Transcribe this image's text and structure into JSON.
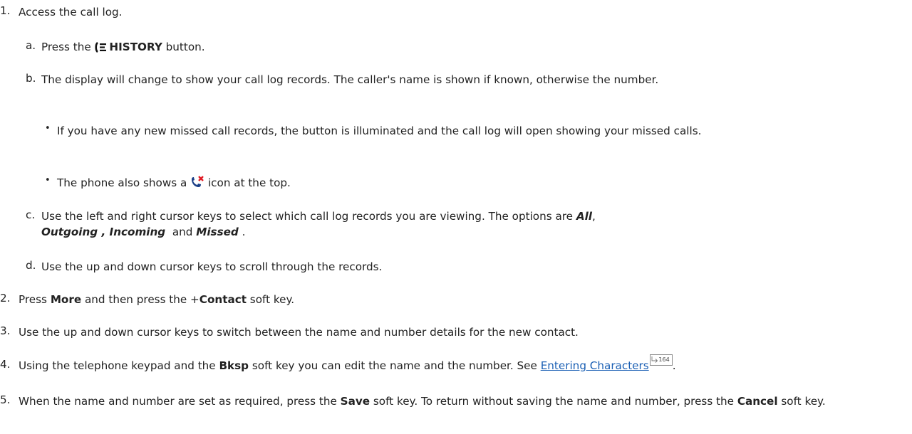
{
  "steps": {
    "s1": {
      "num": "1.",
      "text": "Access the call log.",
      "a": {
        "label": "a.",
        "pre": "Press the ",
        "icon": "history-icon",
        "bold": "HISTORY",
        "post": " button."
      },
      "b": {
        "label": "b.",
        "text": "The display will change to show your call log records. The caller's name is shown if known, otherwise the number.",
        "bullets": {
          "one": "If you have any new missed call records, the button is illuminated and the call log will open showing your missed calls.",
          "two_pre": "The phone also shows a ",
          "two_icon": "missed-call-icon",
          "two_post": " icon at the top."
        }
      },
      "c": {
        "label": "c.",
        "pre": "Use the left and right cursor keys to select which call log records you are viewing. The options are ",
        "all": "All",
        "comma1": ",",
        "outgoing": "Outgoing",
        "comma2": " , ",
        "incoming": "Incoming",
        "and": "  and ",
        "missed": "Missed",
        "end": " ."
      },
      "d": {
        "label": "d.",
        "text": "Use the up and down cursor keys to scroll through the records."
      }
    },
    "s2": {
      "num": "2.",
      "pre": "Press ",
      "more": "More",
      "mid": " and then press the +",
      "contact": "Contact",
      "post": " soft key."
    },
    "s3": {
      "num": "3.",
      "text": "Use the up and down cursor keys to switch between the name and number details for the new contact."
    },
    "s4": {
      "num": "4.",
      "pre": "Using the telephone keypad and the ",
      "bksp": "Bksp",
      "mid": " soft key you can edit the name and the number. See ",
      "link": "Entering Characters",
      "page_ref": "164",
      "end": "."
    },
    "s5": {
      "num": "5.",
      "pre": "When the name and number are set as required, press the ",
      "save": "Save",
      "mid": " soft key. To return without saving the name and number, press the ",
      "cancel": "Cancel",
      "post": " soft key."
    }
  }
}
